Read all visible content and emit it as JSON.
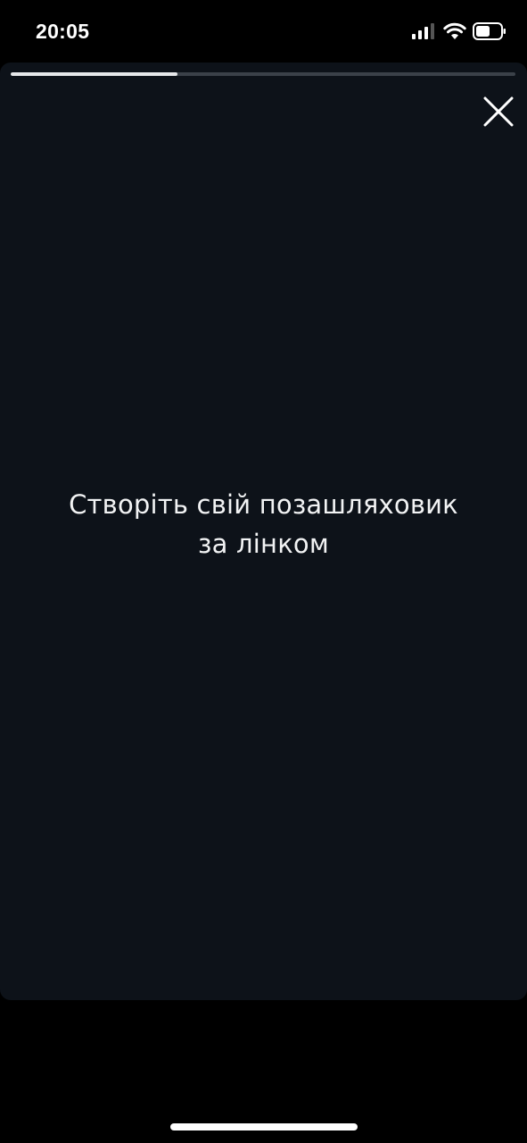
{
  "status_bar": {
    "time": "20:05",
    "icons": [
      "signal-icon",
      "wifi-icon",
      "battery-icon"
    ]
  },
  "story": {
    "progress": 0.33,
    "close_icon": "close-icon",
    "text_line_1": "Створіть свій позашляховик",
    "text_line_2": "за лінком",
    "background_color": "#0d1219",
    "text_color": "#f2f3f4"
  }
}
